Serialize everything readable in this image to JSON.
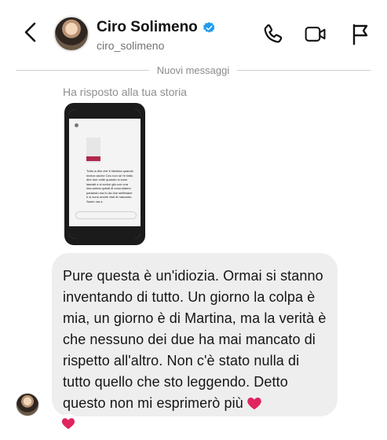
{
  "header": {
    "name": "Ciro Solimeno",
    "handle": "ciro_solimeno",
    "icons": [
      "back-arrow-icon",
      "verified-badge-icon",
      "phone-icon",
      "video-camera-icon",
      "flag-icon"
    ]
  },
  "divider": {
    "label": "Nuovi messaggi"
  },
  "story_reply": {
    "label": "Ha risposto alla tua storia",
    "screen_text": "Tutto a dire che è Martina quando invece anche Ciro non se l'è fatto dire due volte quando si sono lasciati e si scrive già con una mia amica quindi di cosa stiamo parlando ma fu da due settimane e si sono anche visti di nascosto. Santo ma a"
  },
  "message": {
    "text": "Pure questa è un'idiozia. Ormai si stanno inventando di tutto. Un giorno la colpa è mia, un giorno è di Martina, ma la verità è che nessuno dei due ha mai mancato di rispetto all'altro. Non c'è stato nulla di tutto quello che sto leggendo. Detto questo non mi esprimerò più",
    "emoji": "heart-emoji"
  },
  "reaction": {
    "emoji": "heart-emoji"
  },
  "colors": {
    "verified": "#1d9bf0",
    "heart": "#e0245e",
    "bubble": "#eeeeee"
  }
}
